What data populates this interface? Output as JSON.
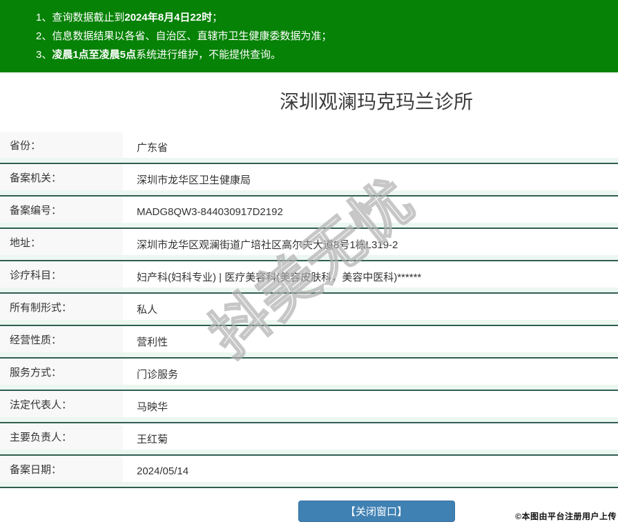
{
  "notice": {
    "bg_color": "#068206",
    "items": [
      {
        "prefix": "1、",
        "pre": "查询数据截止到",
        "bold": "2024年8月4日22时",
        "post": "；"
      },
      {
        "prefix": "2、",
        "pre": "信息数据结果以各省、自治区、直辖市卫生健康委数据为准；",
        "bold": "",
        "post": ""
      },
      {
        "prefix": "3、",
        "pre": "",
        "bold": "凌晨1点至凌晨5点",
        "post": "系统进行维护，不能提供查询。"
      }
    ]
  },
  "title": "深圳观澜玛克玛兰诊所",
  "table": {
    "divider_color": "#2e5d50",
    "rows": [
      {
        "label": "省份：",
        "value": "广东省"
      },
      {
        "label": "备案机关：",
        "value": "深圳市龙华区卫生健康局"
      },
      {
        "label": "备案编号：",
        "value": "MADG8QW3-844030917D2192"
      },
      {
        "label": "地址：",
        "value": "深圳市龙华区观澜街道广培社区高尔夫大道8号1栋L319-2"
      },
      {
        "label": "诊疗科目：",
        "value": "妇产科(妇科专业) | 医疗美容科(美容皮肤科，美容中医科)******"
      },
      {
        "label": "所有制形式：",
        "value": "私人"
      },
      {
        "label": "经营性质：",
        "value": "营利性"
      },
      {
        "label": "服务方式：",
        "value": "门诊服务"
      },
      {
        "label": "法定代表人：",
        "value": "马映华"
      },
      {
        "label": "主要负责人：",
        "value": "王红菊"
      },
      {
        "label": "备案日期：",
        "value": "2024/05/14"
      }
    ]
  },
  "close_button": {
    "label": "【关闭窗口】",
    "bg_color": "#4081b3"
  },
  "watermark": {
    "text": "抖美无忧"
  },
  "footer_note": "©本图由平台注册用户上传"
}
